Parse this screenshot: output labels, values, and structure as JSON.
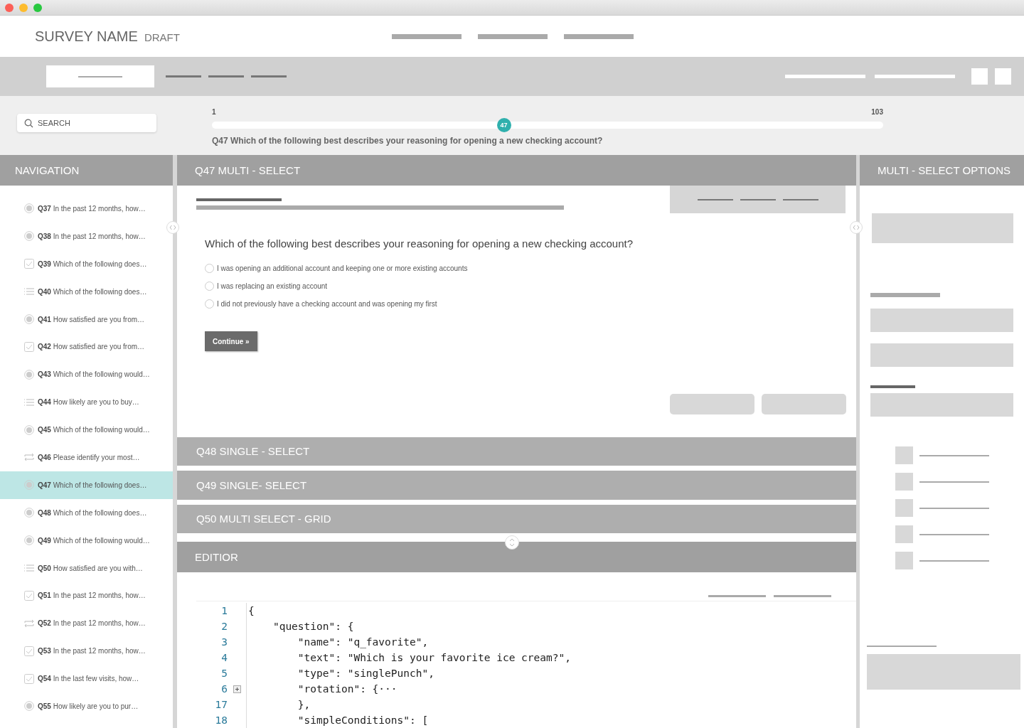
{
  "header": {
    "survey_name": "SURVEY NAME",
    "status": "DRAFT"
  },
  "search": {
    "placeholder": "SEARCH"
  },
  "progress": {
    "start": "1",
    "end": "103",
    "current": "47",
    "level": 0.435,
    "question": "Q47 Which of the following best describes your reasoning for opening a new checking account?"
  },
  "navigation": {
    "title": "NAVIGATION",
    "items": [
      {
        "number": "Q37",
        "text": "In the past 12 months, how…",
        "kind": "radio",
        "selected": false
      },
      {
        "number": "Q38",
        "text": "In the past 12 months, how…",
        "kind": "radio",
        "selected": false
      },
      {
        "number": "Q39",
        "text": "Which of the following does…",
        "kind": "checkbox",
        "selected": false
      },
      {
        "number": "Q40",
        "text": "Which of the following does…",
        "kind": "list",
        "selected": false
      },
      {
        "number": "Q41",
        "text": "How satisfied are you from…",
        "kind": "radio",
        "selected": false
      },
      {
        "number": "Q42",
        "text": "How satisfied are you from…",
        "kind": "checkbox",
        "selected": false
      },
      {
        "number": "Q43",
        "text": "Which of the following would…",
        "kind": "radio",
        "selected": false
      },
      {
        "number": "Q44",
        "text": "How likely are you to buy…",
        "kind": "list",
        "selected": false
      },
      {
        "number": "Q45",
        "text": "Which of the following would…",
        "kind": "radio",
        "selected": false
      },
      {
        "number": "Q46",
        "text": "Please identify your most…",
        "kind": "loop",
        "selected": false
      },
      {
        "number": "Q47",
        "text": "Which of the following does…",
        "kind": "radio",
        "selected": true
      },
      {
        "number": "Q48",
        "text": "Which of the following does…",
        "kind": "radio",
        "selected": false
      },
      {
        "number": "Q49",
        "text": "Which of the following would…",
        "kind": "radio",
        "selected": false
      },
      {
        "number": "Q50",
        "text": "How satisfied are you with…",
        "kind": "list",
        "selected": false
      },
      {
        "number": "Q51",
        "text": "In the past 12 months, how…",
        "kind": "checkbox",
        "selected": false
      },
      {
        "number": "Q52",
        "text": "In the past 12 months, how…",
        "kind": "loop",
        "selected": false
      },
      {
        "number": "Q53",
        "text": "In the past 12 months, how…",
        "kind": "checkbox",
        "selected": false
      },
      {
        "number": "Q54",
        "text": "In the last few visits, how…",
        "kind": "checkbox",
        "selected": false
      },
      {
        "number": "Q55",
        "text": "How likely are you to pur…",
        "kind": "radio",
        "selected": false
      }
    ]
  },
  "question_panel": {
    "title": "Q47 MULTI - SELECT",
    "question": "Which of the following best describes your reasoning for opening a new checking account?",
    "options": [
      {
        "label": "I was opening an additional account and keeping one or more existing accounts",
        "selected": false
      },
      {
        "label": "I was replacing an existing account",
        "selected": false
      },
      {
        "label": "I did not previously have a checking account and was opening my first",
        "selected": false
      }
    ],
    "button": "Continue »"
  },
  "sections": [
    {
      "title": "Q48 SINGLE - SELECT"
    },
    {
      "title": "Q49 SINGLE- SELECT"
    },
    {
      "title": "Q50 MULTI SELECT - GRID"
    }
  ],
  "editor": {
    "title": "EDITIOR",
    "lines": [
      {
        "number": "1",
        "text": "{",
        "collapsed": false
      },
      {
        "number": "2",
        "text": "    \"question\": {",
        "collapsed": false
      },
      {
        "number": "3",
        "text": "        \"name\": \"q_favorite\",",
        "collapsed": false
      },
      {
        "number": "4",
        "text": "        \"text\": \"Which is your favorite ice cream?\",",
        "collapsed": false
      },
      {
        "number": "5",
        "text": "        \"type\": \"singlePunch\",",
        "collapsed": false
      },
      {
        "number": "6",
        "text": "        \"rotation\": {···",
        "collapsed": true
      },
      {
        "number": "17",
        "text": "        },",
        "collapsed": false
      },
      {
        "number": "18",
        "text": "        \"simpleConditions\": [",
        "collapsed": false
      }
    ]
  },
  "options_panel": {
    "title": "MULTI - SELECT OPTIONS"
  }
}
